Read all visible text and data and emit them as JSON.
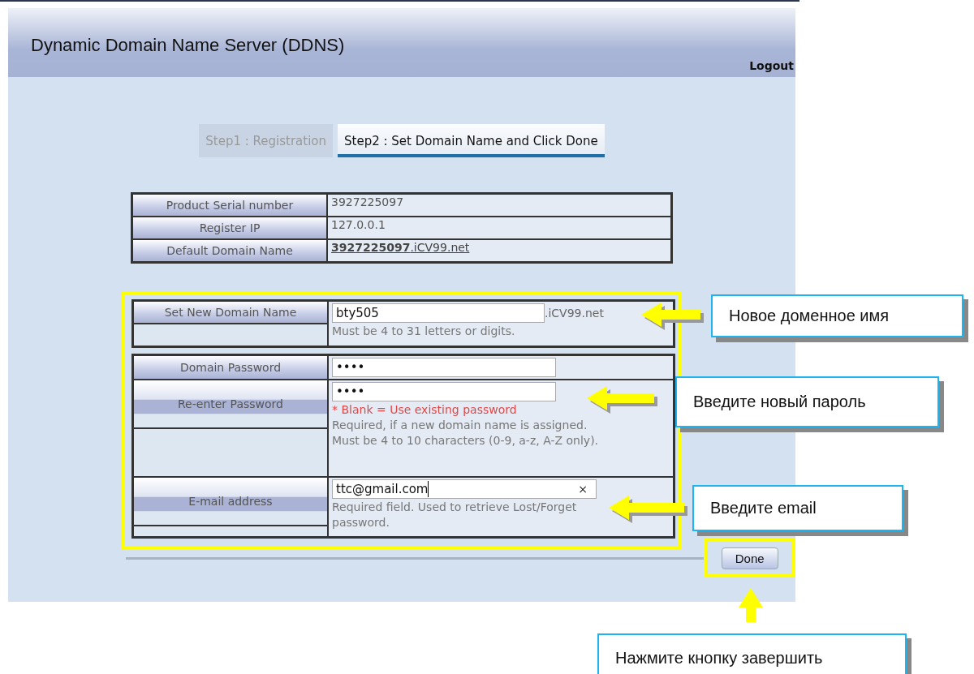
{
  "header": {
    "title": "Dynamic Domain Name Server (DDNS)",
    "logout": "Logout"
  },
  "steps": [
    {
      "label": "Step1 : Registration",
      "selected": false
    },
    {
      "label": "Step2 : Set Domain Name and Click Done",
      "selected": true
    }
  ],
  "info_rows": [
    {
      "label": "Product Serial number",
      "value": "3927225097",
      "kind": "text"
    },
    {
      "label": "Register IP",
      "value": "127.0.0.1",
      "kind": "text"
    },
    {
      "label": "Default Domain Name",
      "value": "**3927225097**.iCV99.net",
      "kind": "link"
    }
  ],
  "domain_section": {
    "label": "Set New Domain Name",
    "value": "bty505",
    "suffix": ".iCV99.net",
    "hint": "Must be 4 to 31 letters or digits."
  },
  "password_section": [
    {
      "label": "Domain Password",
      "value": "••••"
    },
    {
      "label": "Re-enter Password",
      "value": "••••",
      "warning": "* Blank = Use existing password",
      "hint": "Required, if a new domain name is assigned. Must be 4 to 10 characters (0-9, a-z, A-Z only)."
    },
    {
      "label": "E-mail address",
      "value": "ttc@gmail.com",
      "clear": "×",
      "hint": "Required field. Used to retrieve Lost/Forget password."
    }
  ],
  "done_button": "Done",
  "callouts": [
    {
      "text": "Новое доменное имя"
    },
    {
      "text": "Введите новый пароль"
    },
    {
      "text": "Введите email"
    },
    {
      "text": "Нажмите кнопку завершить"
    }
  ]
}
